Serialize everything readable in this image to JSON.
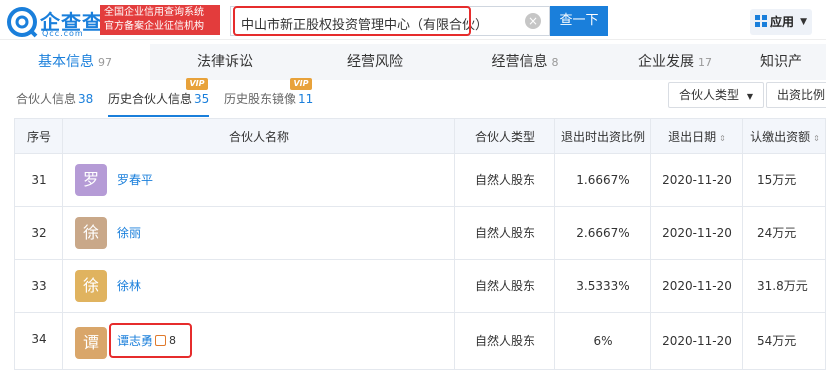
{
  "brand": {
    "logo_text": "企查查",
    "logo_sub": "Qcc.com",
    "slogan_line1": "全国企业信用查询系统",
    "slogan_line2": "官方备案企业征信机构"
  },
  "search": {
    "value": "中山市新正股权投资管理中心（有限合伙）",
    "button": "查一下",
    "clear_icon": "close-circle-icon"
  },
  "apps": {
    "label": "应用",
    "icon": "apps-grid-icon"
  },
  "tabs": [
    {
      "label": "基本信息",
      "count": "97"
    },
    {
      "label": "法律诉讼",
      "count": ""
    },
    {
      "label": "经营风险",
      "count": ""
    },
    {
      "label": "经营信息",
      "count": "8"
    },
    {
      "label": "企业发展",
      "count": "17"
    },
    {
      "label": "知识产",
      "count": ""
    }
  ],
  "subtabs": [
    {
      "label": "合伙人信息",
      "count": "38"
    },
    {
      "label": "历史合伙人信息",
      "count": "35"
    },
    {
      "label": "历史股东镜像",
      "count": "11"
    }
  ],
  "vip_label": "VIP",
  "filters": {
    "partner_type": "合伙人类型",
    "exit_ratio": "出资比例"
  },
  "table": {
    "headers": [
      "序号",
      "合伙人名称",
      "合伙人类型",
      "退出时出资比例",
      "退出日期",
      "认缴出资额"
    ],
    "rows": [
      {
        "no": "31",
        "avatar": "罗",
        "avatar_color": "#b59bd6",
        "name": "罗春平",
        "type": "自然人股东",
        "ratio": "1.6667%",
        "date": "2020-11-20",
        "amount": "15万元"
      },
      {
        "no": "32",
        "avatar": "徐",
        "avatar_color": "#c9a889",
        "name": "徐丽",
        "type": "自然人股东",
        "ratio": "2.6667%",
        "date": "2020-11-20",
        "amount": "24万元"
      },
      {
        "no": "33",
        "avatar": "徐",
        "avatar_color": "#e0b35f",
        "name": "徐林",
        "type": "自然人股东",
        "ratio": "3.5333%",
        "date": "2020-11-20",
        "amount": "31.8万元"
      },
      {
        "no": "34",
        "avatar": "谭",
        "avatar_color": "#d9a66a",
        "name": "谭志勇",
        "type": "自然人股东",
        "ratio": "6%",
        "date": "2020-11-20",
        "amount": "54万元",
        "relation_count": "8"
      }
    ]
  },
  "colors": {
    "accent": "#1a7fdb",
    "highlight": "#e62c2c"
  }
}
